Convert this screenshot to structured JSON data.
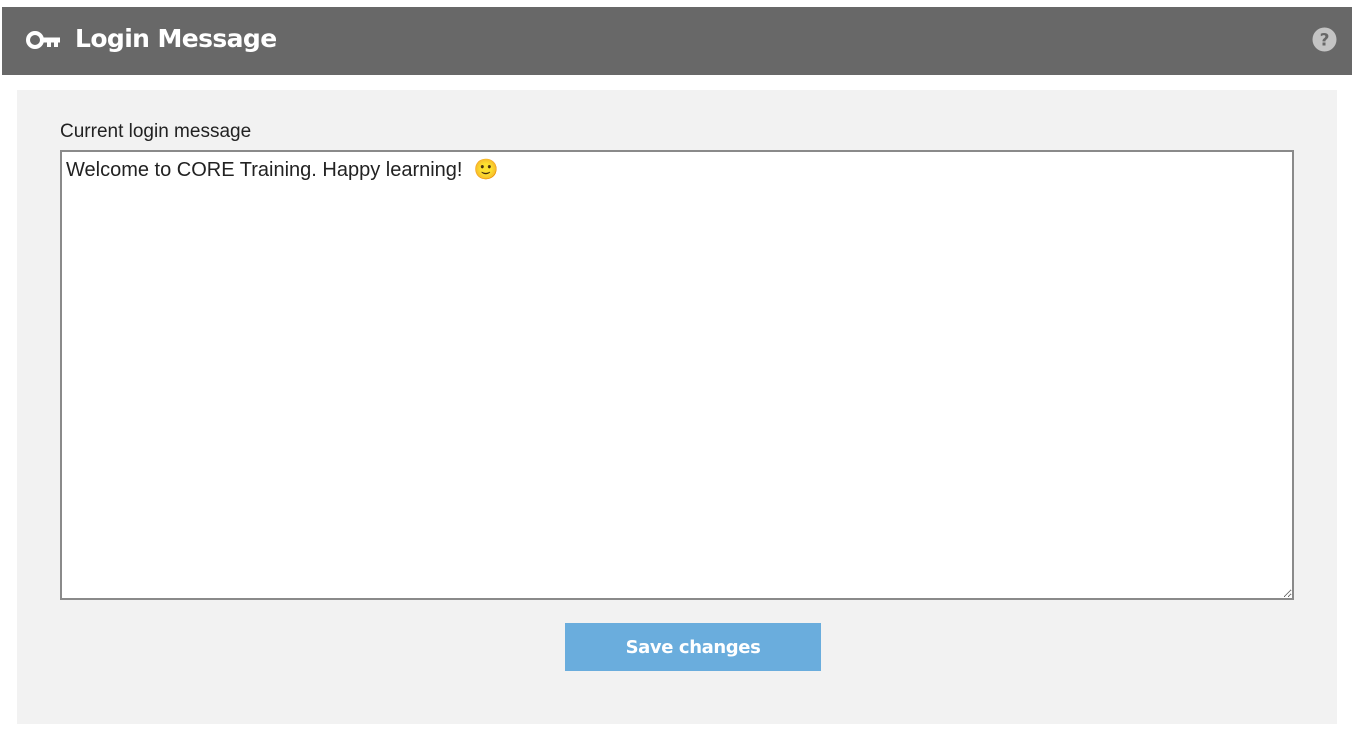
{
  "header": {
    "title": "Login Message",
    "icon": "key-icon",
    "help_icon": "help-icon",
    "bg_color": "#686868"
  },
  "form": {
    "label": "Current login message",
    "message_value": "Welcome to CORE Training. Happy learning!  🙂",
    "save_label": "Save changes",
    "save_color": "#6aaddd"
  }
}
